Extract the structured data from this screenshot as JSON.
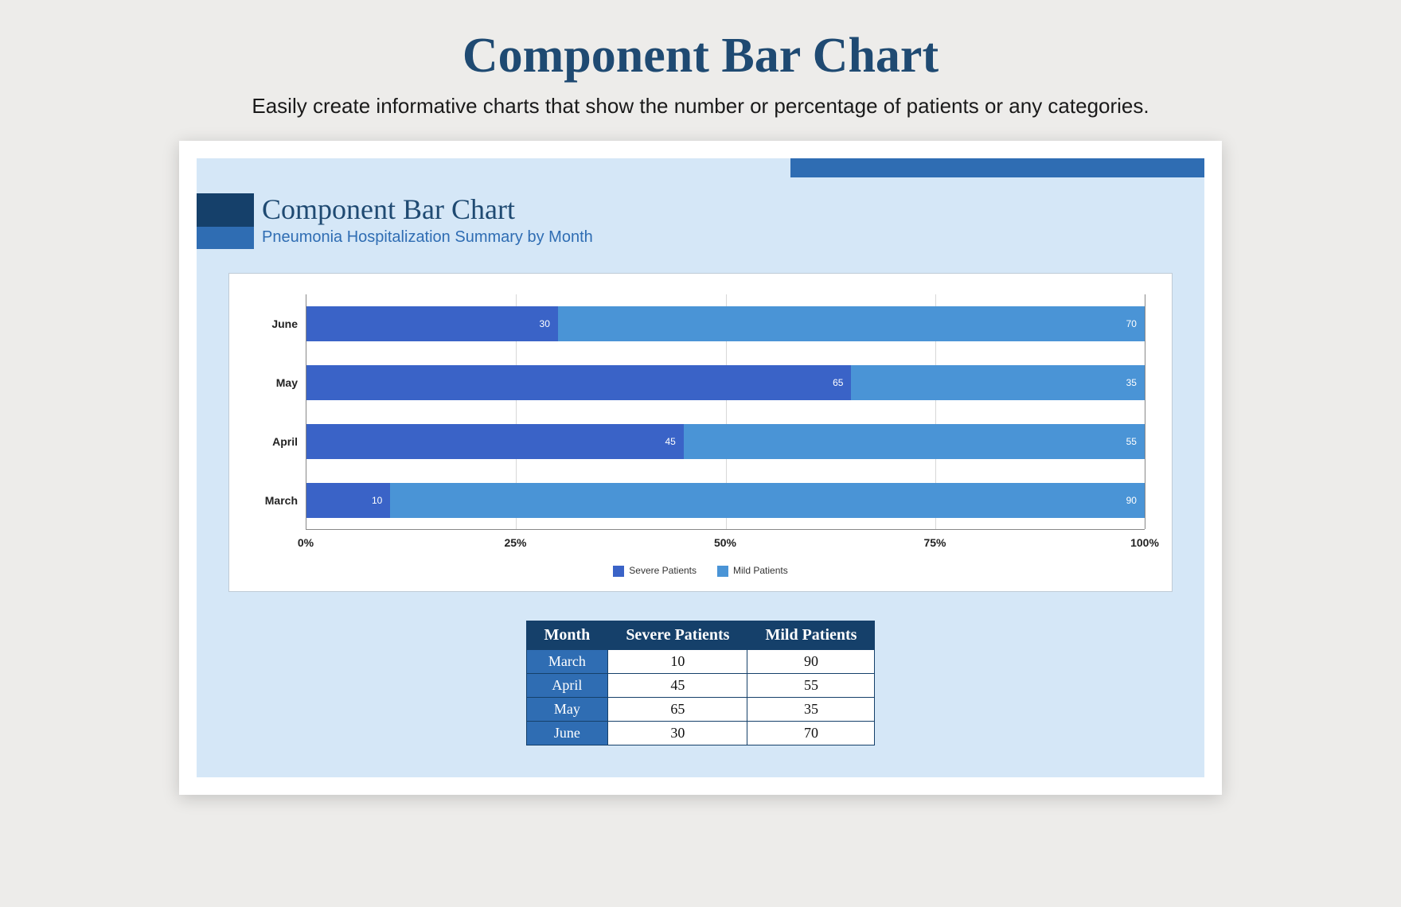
{
  "page": {
    "title": "Component Bar Chart",
    "subtitle": "Easily create informative charts that show the number or percentage of patients or any categories."
  },
  "card": {
    "title": "Component Bar Chart",
    "subtitle": "Pneumonia Hospitalization Summary by Month"
  },
  "legend": {
    "a": "Severe Patients",
    "b": "Mild Patients"
  },
  "xticks": [
    "0%",
    "25%",
    "50%",
    "75%",
    "100%"
  ],
  "table": {
    "headers": [
      "Month",
      "Severe Patients",
      "Mild Patients"
    ],
    "rows": [
      {
        "month": "March",
        "severe": "10",
        "mild": "90"
      },
      {
        "month": "April",
        "severe": "45",
        "mild": "55"
      },
      {
        "month": "May",
        "severe": "65",
        "mild": "35"
      },
      {
        "month": "June",
        "severe": "30",
        "mild": "70"
      }
    ]
  },
  "chart_data": {
    "type": "bar",
    "orientation": "horizontal-stacked-100",
    "categories": [
      "June",
      "May",
      "April",
      "March"
    ],
    "series": [
      {
        "name": "Severe Patients",
        "values": [
          30,
          65,
          45,
          10
        ],
        "color": "#3a63c7"
      },
      {
        "name": "Mild Patients",
        "values": [
          70,
          35,
          55,
          90
        ],
        "color": "#4a94d6"
      }
    ],
    "xlabel": "",
    "ylabel": "",
    "xlim": [
      0,
      100
    ],
    "xticks": [
      0,
      25,
      50,
      75,
      100
    ],
    "title": "Pneumonia Hospitalization Summary by Month"
  }
}
